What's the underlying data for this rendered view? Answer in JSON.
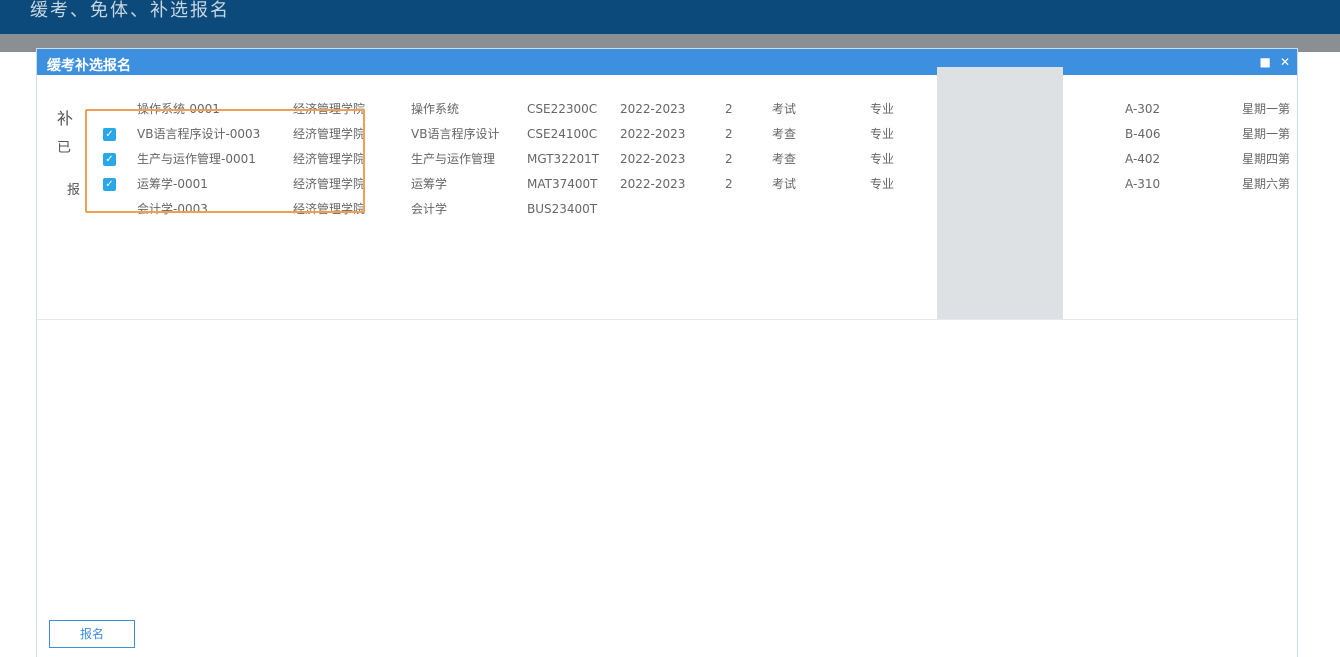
{
  "page_title": "缓考、免体、补选报名",
  "modal": {
    "title": "缓考补选报名",
    "minimize_icon": "square-icon",
    "close_icon": "close-icon"
  },
  "side_labels": [
    "补",
    "已",
    "报"
  ],
  "courses": [
    {
      "checked": false,
      "name": "操作系统-0001",
      "college": "经济管理学院",
      "subject": "操作系统",
      "code": "CSE22300C",
      "year": "2022-2023",
      "credit": "2",
      "exam": "考试",
      "type": "专业",
      "room": "A-302",
      "time": "星期一第"
    },
    {
      "checked": true,
      "name": "VB语言程序设计-0003",
      "college": "经济管理学院",
      "subject": "VB语言程序设计",
      "code": "CSE24100C",
      "year": "2022-2023",
      "credit": "2",
      "exam": "考查",
      "type": "专业",
      "room": "B-406",
      "time": "星期一第"
    },
    {
      "checked": true,
      "name": "生产与运作管理-0001",
      "college": "经济管理学院",
      "subject": "生产与运作管理",
      "code": "MGT32201T",
      "year": "2022-2023",
      "credit": "2",
      "exam": "考查",
      "type": "专业",
      "room": "A-402",
      "time": "星期四第"
    },
    {
      "checked": true,
      "name": "运筹学-0001",
      "college": "经济管理学院",
      "subject": "运筹学",
      "code": "MAT37400T",
      "year": "2022-2023",
      "credit": "2",
      "exam": "考试",
      "type": "专业",
      "room": "A-310",
      "time": "星期六第"
    },
    {
      "checked": false,
      "name": "会计学-0003",
      "college": "经济管理学院",
      "subject": "会计学",
      "code": "BUS23400T",
      "year": "",
      "credit": "",
      "exam": "",
      "type": "",
      "room": "",
      "time": ""
    }
  ],
  "lower": {
    "button_label": "报名"
  }
}
